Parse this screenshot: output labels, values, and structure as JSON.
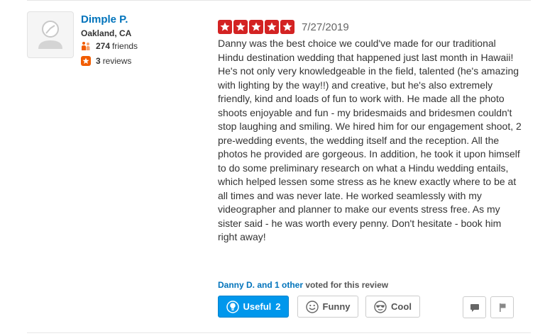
{
  "user": {
    "name": "Dimple P.",
    "location": "Oakland, CA",
    "friends_count": "274",
    "friends_label": "friends",
    "reviews_count": "3",
    "reviews_label": "reviews"
  },
  "review": {
    "rating": 5,
    "rating_max": 5,
    "date": "7/27/2019",
    "text": "Danny was the best choice we could've made for our traditional Hindu destination wedding that happened just last month in Hawaii! He's not only very knowledgeable in the field, talented (he's amazing with lighting by the way!!) and creative, but he's also extremely friendly, kind and loads of fun to work with. He made all the photo shoots enjoyable and fun - my bridesmaids and bridesmen couldn't stop laughing and smiling. We hired him for our engagement shoot, 2 pre-wedding events, the wedding itself and the reception.  All the photos he provided are gorgeous. In addition, he took it upon himself to do some preliminary research on what a Hindu wedding entails, which helped lessen some stress as he knew exactly where to be at all times and was never late. He worked seamlessly with my videographer and planner to make our events stress free. As my sister said - he was worth every penny. Don't hesitate - book him right away!"
  },
  "votes": {
    "voters_link": "Danny D. and 1 other",
    "voted_text": "voted for this review"
  },
  "actions": {
    "useful_label": "Useful",
    "useful_count": "2",
    "funny_label": "Funny",
    "cool_label": "Cool"
  },
  "colors": {
    "star_red": "#d32323",
    "link_blue": "#0073bb",
    "useful_blue": "#0097ec",
    "friends_orange": "#f15c00",
    "reviews_orange": "#f15c00"
  },
  "icons": {
    "avatar": "default-user-icon",
    "friends": "friends-icon",
    "reviews": "review-star-icon",
    "useful": "lightbulb-icon",
    "funny": "smiley-icon",
    "cool": "sunglasses-icon",
    "comment": "speech-bubble-icon",
    "flag": "flag-icon"
  }
}
